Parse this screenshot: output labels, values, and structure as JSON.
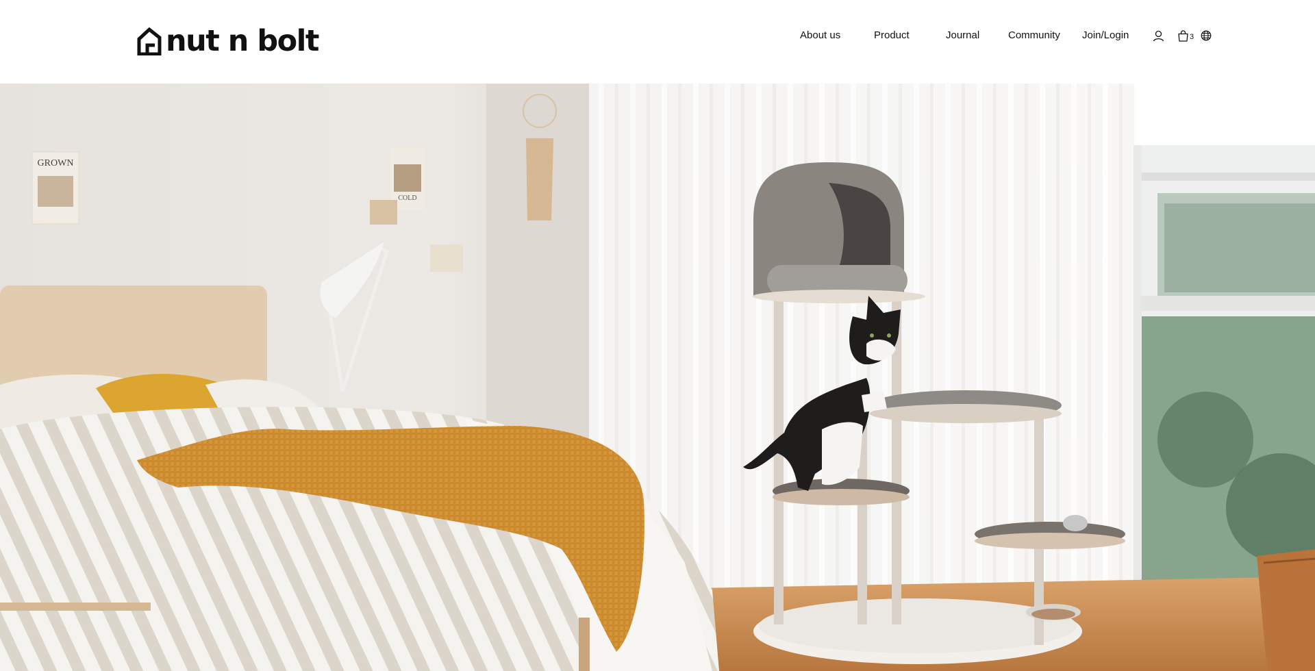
{
  "brand": {
    "name": "nut n bolt",
    "logo_icon": "house-logo-icon"
  },
  "nav": {
    "items": [
      {
        "label": "About us"
      },
      {
        "label": "Product"
      },
      {
        "label": "Journal"
      },
      {
        "label": "Community"
      },
      {
        "label": "Join/Login"
      }
    ]
  },
  "utility": {
    "user_icon": "user-icon",
    "cart_icon": "shopping-bag-icon",
    "cart_count": "3",
    "language_icon": "globe-icon"
  },
  "hero": {
    "image": "hero-photo",
    "poster_text_1": "GROWN",
    "poster_text_2": "COLD",
    "colors": {
      "wall": "#e9e6e1",
      "curtain": "#f4f3f1",
      "mustard": "#d99c2e",
      "blanket": "#c9862c",
      "wood_floor": "#c98b4d",
      "window_green": "#6e8f73"
    }
  }
}
